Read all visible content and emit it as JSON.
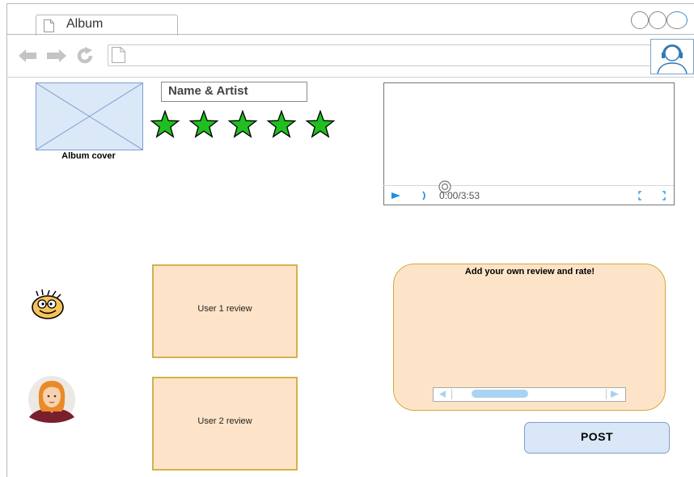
{
  "browser": {
    "tab_title": "Album",
    "url_value": ""
  },
  "album": {
    "cover_label": "Album cover",
    "name_artist": "Name & Artist",
    "rating_stars": 5,
    "star_color": "#1fbf1f"
  },
  "player": {
    "time": "0:00/3:53"
  },
  "reviews": [
    {
      "text": "User 1 review",
      "avatar": "smiley-glasses-avatar-icon"
    },
    {
      "text": "User 2 review",
      "avatar": "woman-avatar-icon"
    }
  ],
  "add_review": {
    "title": "Add your own review and rate!"
  },
  "post_button": "POST",
  "colors": {
    "review_bg": "#fde4c9",
    "review_border": "#d4b24a",
    "button_bg": "#d9e7f9",
    "accent": "#1f8fe0"
  }
}
